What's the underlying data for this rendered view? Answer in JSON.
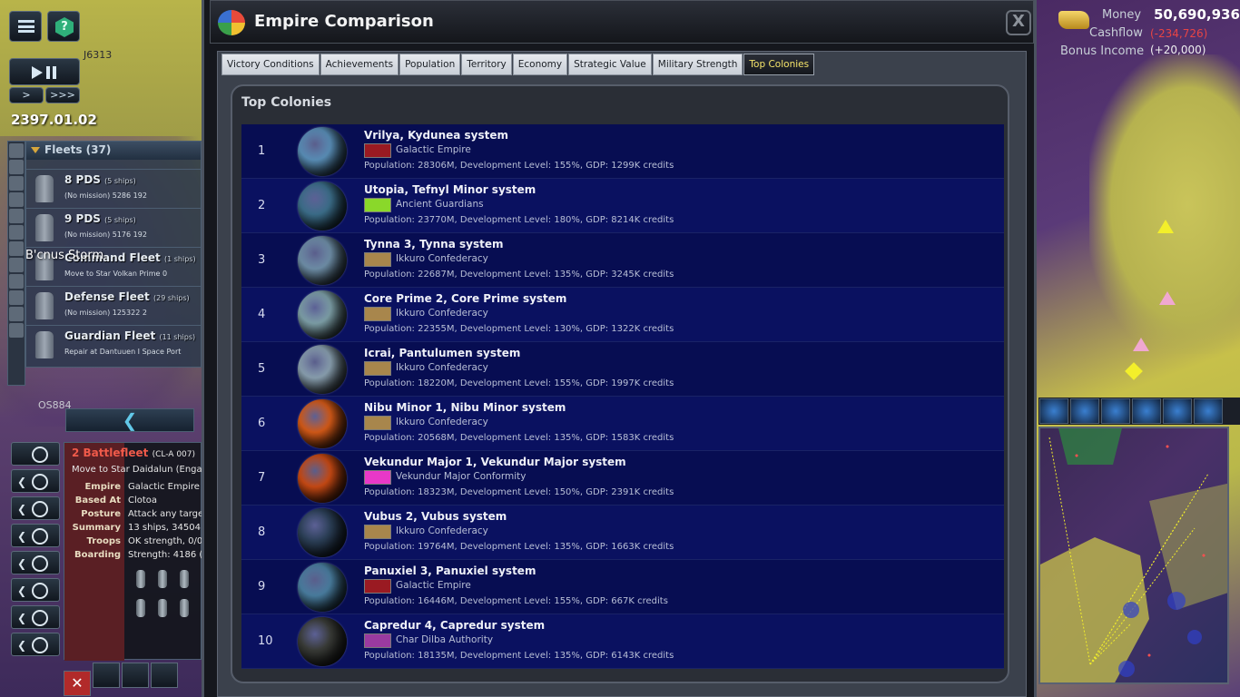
{
  "hud": {
    "date": "2397.01.02",
    "speed_slow": ">",
    "speed_fast": ">>>",
    "sector_top": "J6313",
    "sector_bottom": "OS884",
    "storm_label": "B'cnus Storm"
  },
  "fleets": {
    "header": "Fleets (37)",
    "items": [
      {
        "name": "8 PDS",
        "ships": "(5 ships)",
        "mission": "(No mission)   5286   192"
      },
      {
        "name": "9 PDS",
        "ships": "(5 ships)",
        "mission": "(No mission)   5176   192"
      },
      {
        "name": "Command Fleet",
        "ships": "(1 ships)",
        "mission": "Move to Star Volkan Prime   0"
      },
      {
        "name": "Defense Fleet",
        "ships": "(29 ships)",
        "mission": "(No mission)   125322   2"
      },
      {
        "name": "Guardian Fleet",
        "ships": "(11 ships)",
        "mission": "Repair at Dantuuen I Space Port"
      }
    ],
    "back_icon": "chevron-left-icon"
  },
  "selected_fleet": {
    "title": "2 Battlefleet",
    "code": "(CL-A 007)",
    "move": "Move to Star Daidalun (Engag",
    "rows": [
      {
        "k": "Empire",
        "v": "Galactic Empire"
      },
      {
        "k": "Based At",
        "v": "Clotoa"
      },
      {
        "k": "Posture",
        "v": "Attack any targe"
      },
      {
        "k": "Summary",
        "v": "13 ships, 34504 ("
      },
      {
        "k": "Troops",
        "v": "OK strength, 0/0"
      },
      {
        "k": "Boarding",
        "v": "Strength: 4186  ("
      }
    ]
  },
  "dialog": {
    "title": "Empire Comparison",
    "close": "X",
    "tabs": [
      "Victory Conditions",
      "Achievements",
      "Population",
      "Territory",
      "Economy",
      "Strategic Value",
      "Military Strength",
      "Top Colonies"
    ],
    "active_tab": "Top Colonies",
    "section_title": "Top Colonies"
  },
  "colonies": [
    {
      "rank": "1",
      "name": "Vrilya, Kydunea system",
      "empire": "Galactic Empire",
      "stats": "Population: 28306M,  Development Level: 155%,  GDP: 1299K credits",
      "planet": "#5a8fb8",
      "flag": "#9a1a22"
    },
    {
      "rank": "2",
      "name": "Utopia, Tefnyl Minor system",
      "empire": "Ancient Guardians",
      "stats": "Population: 23770M,  Development Level: 180%,  GDP: 8214K credits",
      "planet": "#3c6e8a",
      "flag": "#8ad82a"
    },
    {
      "rank": "3",
      "name": "Tynna 3, Tynna system",
      "empire": "Ikkuro Confederacy",
      "stats": "Population: 22687M,  Development Level: 135%,  GDP: 3245K credits",
      "planet": "#6f8fa8",
      "flag": "#a8864c"
    },
    {
      "rank": "4",
      "name": "Core Prime 2, Core Prime system",
      "empire": "Ikkuro Confederacy",
      "stats": "Population: 22355M,  Development Level: 130%,  GDP: 1322K credits",
      "planet": "#7ea0a8",
      "flag": "#a8864c"
    },
    {
      "rank": "5",
      "name": "Icrai, Pantulumen system",
      "empire": "Ikkuro Confederacy",
      "stats": "Population: 18220M,  Development Level: 155%,  GDP: 1997K credits",
      "planet": "#8aa0b0",
      "flag": "#a8864c"
    },
    {
      "rank": "6",
      "name": "Nibu Minor 1, Nibu Minor system",
      "empire": "Ikkuro Confederacy",
      "stats": "Population: 20568M,  Development Level: 135%,  GDP: 1583K credits",
      "planet": "#d45a18",
      "flag": "#a8864c"
    },
    {
      "rank": "7",
      "name": "Vekundur Major 1, Vekundur Major system",
      "empire": "Vekundur Major Conformity",
      "stats": "Population: 18323M,  Development Level: 150%,  GDP: 2391K credits",
      "planet": "#c84a14",
      "flag": "#e838c8"
    },
    {
      "rank": "8",
      "name": "Vubus 2, Vubus system",
      "empire": "Ikkuro Confederacy",
      "stats": "Population: 19764M,  Development Level: 135%,  GDP: 1663K credits",
      "planet": "#2c4058",
      "flag": "#a8864c"
    },
    {
      "rank": "9",
      "name": "Panuxiel 3, Panuxiel system",
      "empire": "Galactic Empire",
      "stats": "Population: 16446M,  Development Level: 155%,  GDP: 667K credits",
      "planet": "#4a7ea0",
      "flag": "#9a1a22"
    },
    {
      "rank": "10",
      "name": "Capredur 4, Capredur system",
      "empire": "Char Dilba Authority",
      "stats": "Population: 18135M,  Development Level: 135%,  GDP: 6143K credits",
      "planet": "#3a3c38",
      "flag": "#9a3aa0"
    }
  ],
  "finance": {
    "money_label": "Money",
    "money_value": "50,690,936",
    "cashflow_label": "Cashflow",
    "cashflow_value": "(-234,726)",
    "bonus_label": "Bonus Income",
    "bonus_value": "(+20,000)"
  }
}
